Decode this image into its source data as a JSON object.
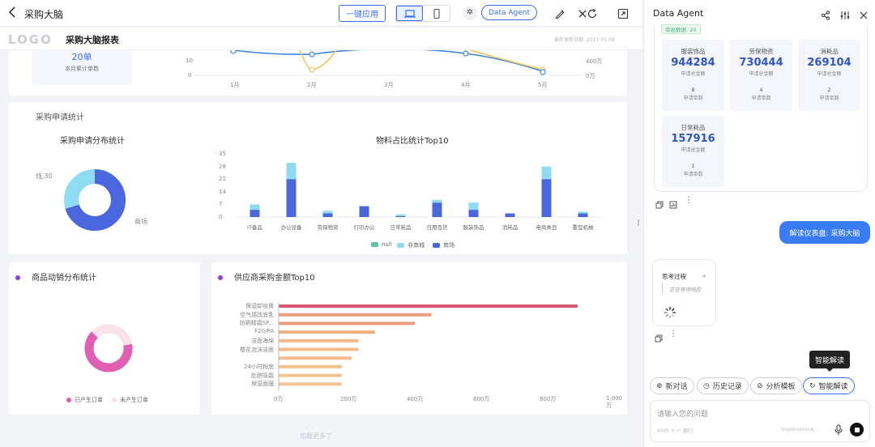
{
  "topbar": {
    "title": "采购大脑",
    "one_click_apply": "一键应用",
    "agent_pill": "Data Agent"
  },
  "report": {
    "logo": "LOGO",
    "title": "采购大脑报表",
    "update_date": "最新更新日期: 2017-05-08"
  },
  "kpi": {
    "value": "20单",
    "label": "本月累计单数"
  },
  "line_chart": {
    "left_ticks": [
      "10",
      "0"
    ],
    "right_ticks": [
      "400万",
      "0万"
    ],
    "months": [
      "1月",
      "2月",
      "3月",
      "4月",
      "5月"
    ]
  },
  "section_purchase": {
    "title": "采购申请统计",
    "donut_title": "采购申请分布统计",
    "donut_label_left": "线,30",
    "donut_label_right": "商场",
    "bar_title": "物料占比统计Top10"
  },
  "chart_data": [
    {
      "type": "bar",
      "title": "物料占比统计Top10",
      "categories": [
        "IT备品",
        "办公设备",
        "劳保物资",
        "打印办公",
        "日常耗品",
        "日用百货",
        "服装饰品",
        "消耗品",
        "电商类目",
        "重型机械"
      ],
      "series": [
        {
          "name": "null",
          "color": "#5bc8a0",
          "values": [
            0,
            0,
            0,
            0,
            0,
            0,
            0,
            0,
            0,
            0
          ]
        },
        {
          "name": "非商城",
          "color": "#8fdcf2",
          "values": [
            3,
            9,
            1.5,
            0,
            1,
            1.5,
            4,
            0,
            7,
            1
          ]
        },
        {
          "name": "商场",
          "color": "#4a67de",
          "values": [
            4,
            21,
            2,
            6,
            0.5,
            8,
            4,
            2,
            21,
            2
          ]
        }
      ],
      "y_ticks": [
        "35",
        "28",
        "21",
        "14",
        "7",
        "0"
      ],
      "ylim": [
        0,
        35
      ],
      "legend": "bottom"
    },
    {
      "type": "bar",
      "title": "供应商采购金额Top10",
      "orientation": "horizontal",
      "categories": [
        "保湿卸妆膏",
        "空气感改底乳",
        "防晒精霜SP...",
        "F20/PA",
        "洁面海绵",
        "樱花泡沫洁面",
        "",
        "24小时粉底",
        "肚脐隐霜",
        "保湿面膜"
      ],
      "values": [
        900,
        460,
        410,
        290,
        240,
        240,
        220,
        190,
        190,
        190
      ],
      "x_ticks": [
        "0万",
        "200万",
        "400万",
        "600万",
        "800万",
        "1,000万"
      ],
      "xlim": [
        0,
        1000
      ]
    },
    {
      "type": "pie",
      "title": "商品动销分布统计",
      "categories": [
        "已产生订单",
        "未产生订单"
      ],
      "values": [
        65,
        35
      ],
      "colors": [
        "#e05fb3",
        "#f9e2ea"
      ]
    }
  ],
  "section_sales": {
    "title": "商品动销分布统计",
    "legend": [
      "已产生订单",
      "未产生订单"
    ]
  },
  "section_supplier": {
    "title": "供应商采购金额Top10"
  },
  "scroll_hint": "加载更多了",
  "panel": {
    "title": "Data Agent",
    "badge": "审批数据: 20",
    "categories": [
      {
        "name": "服装饰品",
        "amount": "944284",
        "amount_label": "申请总金额",
        "count": "8",
        "count_label": "申请单数"
      },
      {
        "name": "劳保物资",
        "amount": "730444",
        "amount_label": "申请总金额",
        "count": "4",
        "count_label": "申请单数"
      },
      {
        "name": "消耗品",
        "amount": "269104",
        "amount_label": "申请总金额",
        "count": "2",
        "count_label": "申请单数"
      },
      {
        "name": "日常耗品",
        "amount": "157916",
        "amount_label": "申请总金额",
        "count": "1",
        "count_label": "申请单数"
      }
    ],
    "user_message": "解读仪表盘: 采购大脑",
    "thinking_title": "思考过程",
    "thinking_status": "正在等待响应",
    "tooltip": "智能解读",
    "tools": [
      "新对话",
      "历史记录",
      "分析模板",
      "智能解读"
    ],
    "input_placeholder": "请输入您的问题",
    "input_hint": "Shift + ↵ 换行",
    "input_brand": "Supersonicq..."
  }
}
